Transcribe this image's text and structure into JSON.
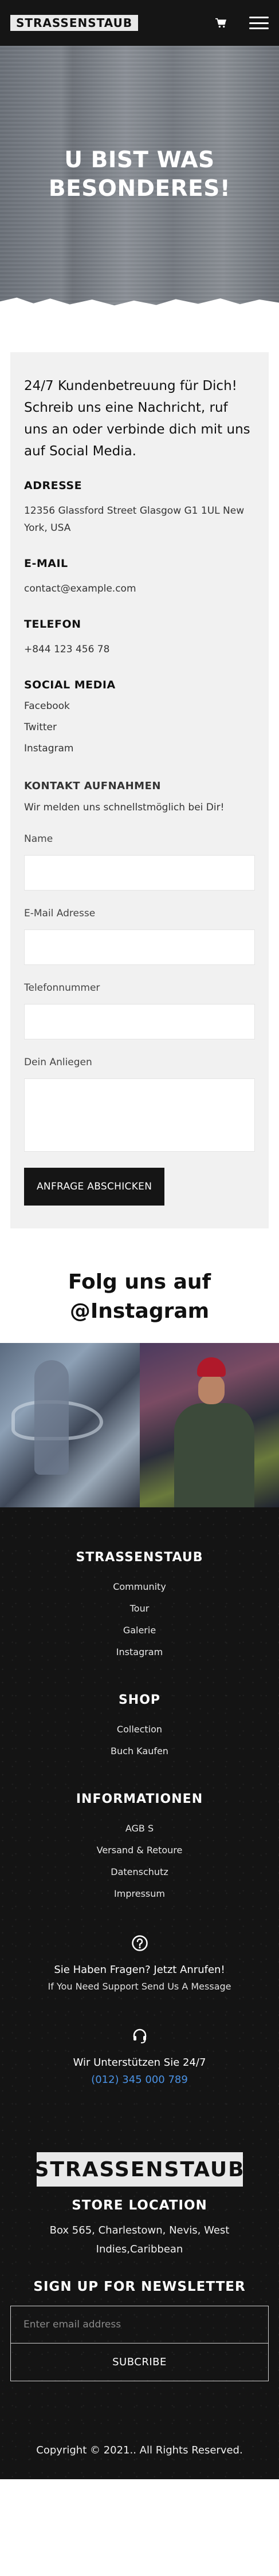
{
  "header": {
    "logo_text": "STRASSENSTAUB",
    "cart_icon": "cart-icon",
    "menu_icon": "hamburger-menu-icon"
  },
  "hero": {
    "title": "U BIST WAS BESONDERES!"
  },
  "contact": {
    "intro": "24/7 Kundenbetreuung für Dich! Schreib uns eine Nachricht, ruf uns an oder verbinde dich mit uns auf Social Media.",
    "address_heading": "ADRESSE",
    "address_text": "12356 Glassford Street Glasgow G1 1UL New York, USA",
    "email_heading": "E-MAIL",
    "email_text": "contact@example.com",
    "phone_heading": "TELEFON",
    "phone_text": "+844 123 456 78",
    "social_heading": "SOCIAL MEDIA",
    "social_links": [
      "Facebook",
      "Twitter",
      "Instagram"
    ],
    "form_heading": "KONTAKT AUFNAHMEN",
    "form_subtext": "Wir melden uns schnellstmöglich bei Dir!",
    "name_label": "Name",
    "email_label": "E-Mail Adresse",
    "phone_label": "Telefonnummer",
    "message_label": "Dein Anliegen",
    "submit_label": "ANFRAGE ABSCHICKEN"
  },
  "instagram": {
    "heading": "Folg uns auf @Instagram"
  },
  "footer": {
    "brand_heading": "STRASSENSTAUB",
    "brand_links": [
      "Community",
      "Tour",
      "Galerie",
      "Instagram"
    ],
    "shop_heading": "SHOP",
    "shop_links": [
      "Collection",
      "Buch Kaufen"
    ],
    "info_heading": "INFORMATIONEN",
    "info_links": [
      "AGB S",
      "Versand & Retoure",
      "Datenschutz",
      "Impressum"
    ],
    "help_icon": "question-circle-icon",
    "help_line1": "Sie Haben Fragen? Jetzt Anrufen!",
    "help_line2": "If You Need Support Send Us A Message",
    "support_icon": "headset-icon",
    "support_line": "Wir Unterstützen Sie 24/7",
    "support_phone": "(012) 345 000 789",
    "logo_text": "STRASSENSTAUB",
    "store_heading": "STORE LOCATION",
    "store_text": "Box 565, Charlestown, Nevis, West Indies,Caribbean",
    "newsletter_heading": "SIGN UP FOR NEWSLETTER",
    "newsletter_placeholder": "Enter email address",
    "newsletter_button": "SUBCRIBE",
    "copyright": "Copyright © 2021.. All Rights Reserved."
  }
}
